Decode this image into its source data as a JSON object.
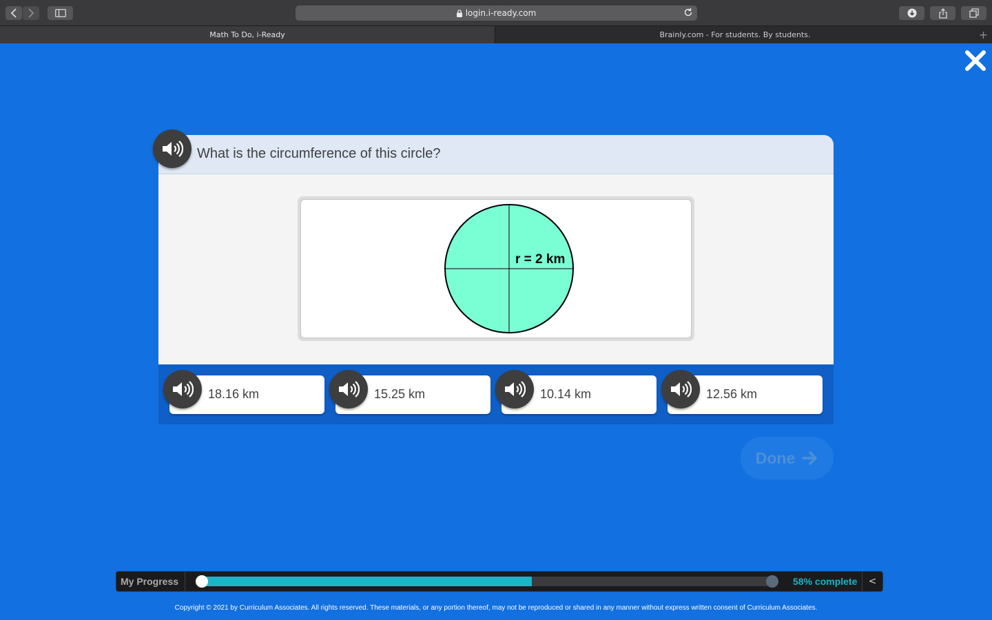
{
  "browser": {
    "url": "login.i-ready.com",
    "tabs": [
      {
        "label": "Math To Do, i-Ready"
      },
      {
        "label": "Brainly.com - For students. By students."
      }
    ],
    "new_tab_glyph": "+"
  },
  "question": {
    "text": "What is the circumference of this circle?",
    "figure": {
      "label": "r = 2 km",
      "fill_color": "#7affd4"
    }
  },
  "answers": [
    {
      "label": "18.16 km"
    },
    {
      "label": "15.25 km"
    },
    {
      "label": "10.14 km"
    },
    {
      "label": "12.56 km"
    }
  ],
  "done_button": {
    "label": "Done"
  },
  "progress": {
    "label": "My Progress",
    "percent": 58,
    "percent_text": "58% complete",
    "collapse_glyph": "<"
  },
  "copyright": "Copyright © 2021 by Curriculum Associates. All rights reserved. These materials, or any portion thereof, may not be reproduced or shared in any manner without express written consent of Curriculum Associates.",
  "icons": [
    "back-icon",
    "forward-icon",
    "sidebar-icon",
    "lock-icon",
    "reload-icon",
    "download-icon",
    "share-icon",
    "tabs-overview-icon",
    "close-icon",
    "speaker-icon",
    "arrow-right-icon"
  ],
  "colors": {
    "background": "#1270e0",
    "progress_fill": "#1bb5c7"
  }
}
